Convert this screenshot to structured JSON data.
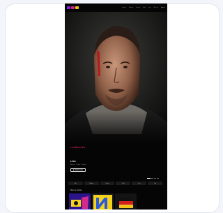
{
  "header": {
    "brand_colors": [
      "#7b2bd8",
      "#d6208f",
      "#f0c21b"
    ],
    "nav": [
      "Home",
      "Movies",
      "Series",
      "Kids",
      "Live",
      "My List"
    ],
    "signin": "Sign in"
  },
  "hero": {
    "badge": "LANDSCAPE",
    "title": "Léon",
    "subtitle": "Action · Crime · Drama",
    "watch_label": "Watch now",
    "play_icon": "play-icon"
  },
  "tabs": [
    "All",
    "Movies",
    "Series",
    "Kids",
    "Live",
    "Top"
  ],
  "row": {
    "title": "More to explore",
    "items": [
      {
        "name": "thumb-1",
        "bg": "#3a1f9e"
      },
      {
        "name": "thumb-2",
        "bg": "#1a1a1a"
      },
      {
        "name": "thumb-3",
        "bg": "#111111"
      }
    ]
  },
  "accent_color": "#e0225f"
}
